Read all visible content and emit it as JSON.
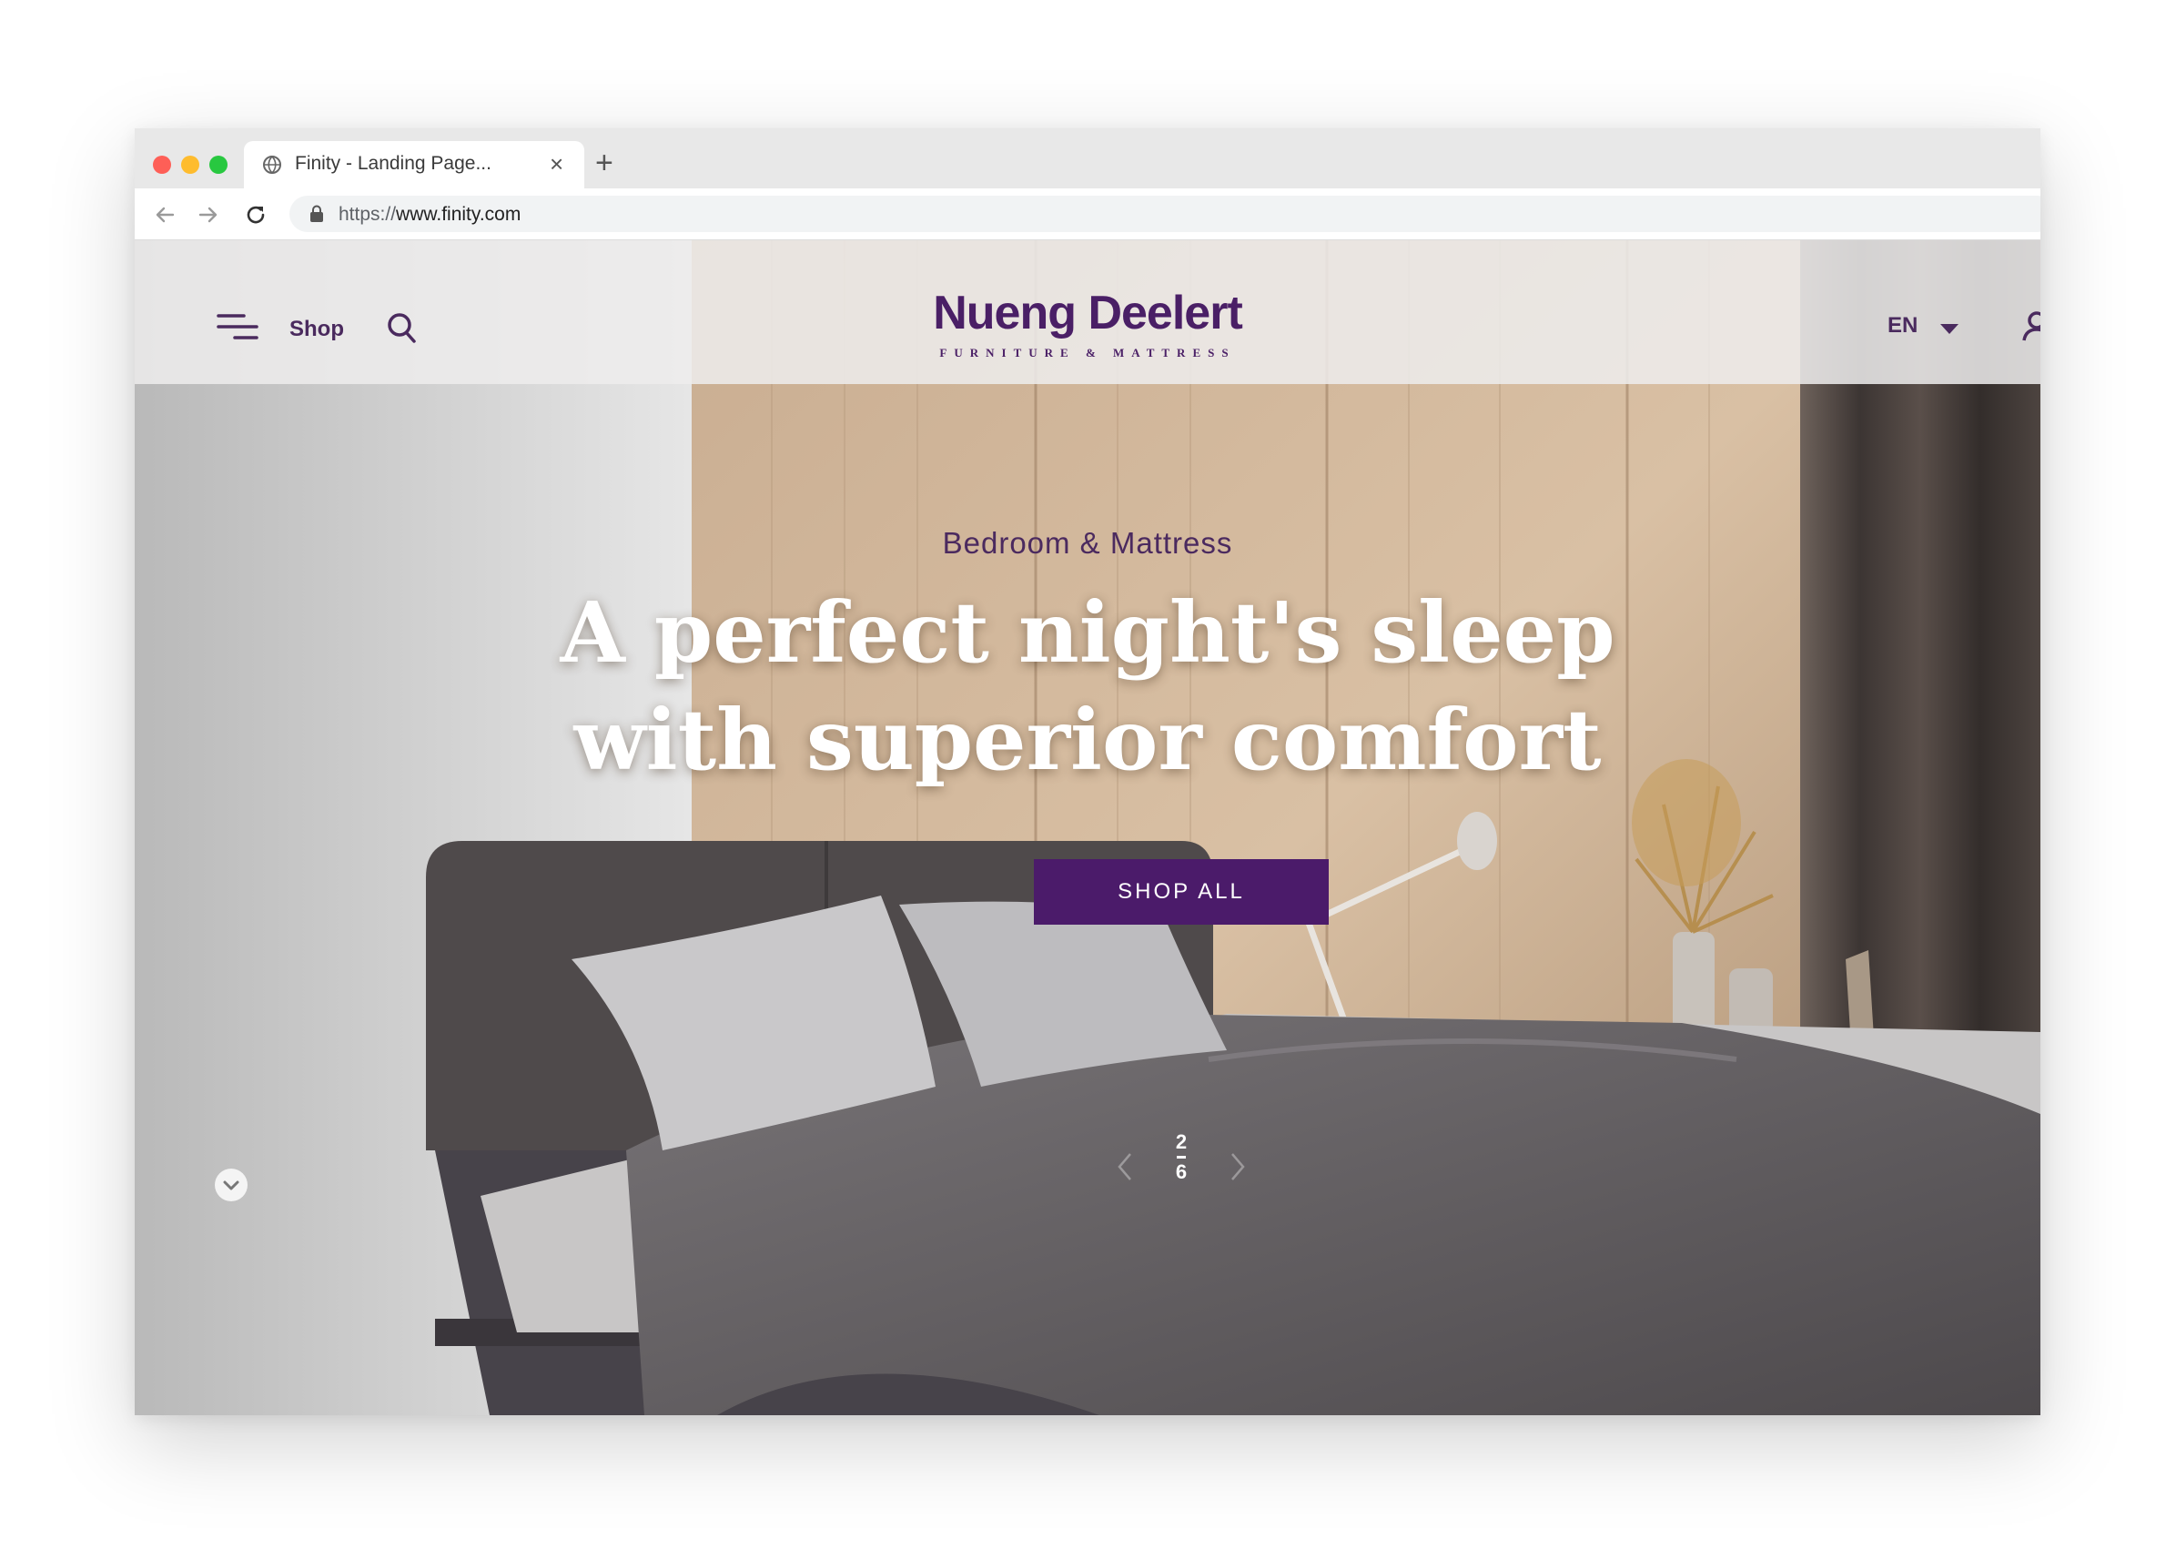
{
  "browser": {
    "tab_title": "Finity - Landing Page...",
    "tab_close": "×",
    "new_tab": "+",
    "url_scheme": "https://",
    "url_host": "www.finity.com"
  },
  "header": {
    "shop_label": "Shop",
    "brand_name": "Nueng Deelert",
    "brand_tagline": "FURNITURE & MATTRESS",
    "language": "EN"
  },
  "hero": {
    "eyebrow": "Bedroom & Mattress",
    "title_line1": "A perfect night's sleep",
    "title_line2": "with superior comfort",
    "cta_label": "SHOP ALL",
    "slide_current": "2",
    "slide_total": "6"
  },
  "colors": {
    "brand_purple": "#4b1b6a",
    "text_purple": "#4a2a5e",
    "header_bg": "#eeecec"
  },
  "icons": [
    "globe-icon",
    "back-arrow-icon",
    "forward-arrow-icon",
    "reload-icon",
    "lock-icon",
    "hamburger-menu-icon",
    "search-icon",
    "caret-down-icon",
    "user-icon",
    "chevron-left-icon",
    "chevron-right-icon",
    "chevron-down-icon"
  ]
}
